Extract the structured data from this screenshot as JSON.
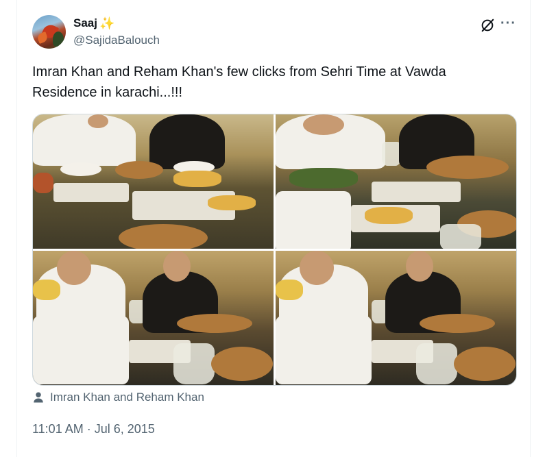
{
  "tweet": {
    "author_name": "Saaj",
    "author_emoji": "✨",
    "author_handle": "@SajidaBalouch",
    "text": "Imran Khan and Reham Khan's few clicks from Sehri Time at Vawda Residence in karachi...!!!",
    "tagged_people": "Imran Khan and Reham Khan",
    "timestamp": "11:01 AM · Jul 6, 2015",
    "more_glyph": "···"
  },
  "icons": {
    "grok": "grok-icon",
    "more": "more-icon",
    "person": "person-icon"
  },
  "colors": {
    "text_primary": "#0f1419",
    "text_secondary": "#536471",
    "border": "#cfd9de"
  }
}
